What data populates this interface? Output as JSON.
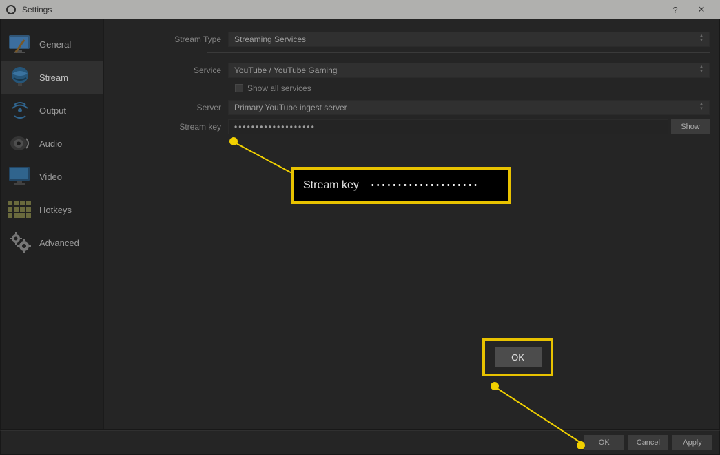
{
  "window": {
    "title": "Settings",
    "help": "?",
    "close": "✕"
  },
  "sidebar": {
    "items": [
      {
        "label": "General"
      },
      {
        "label": "Stream"
      },
      {
        "label": "Output"
      },
      {
        "label": "Audio"
      },
      {
        "label": "Video"
      },
      {
        "label": "Hotkeys"
      },
      {
        "label": "Advanced"
      }
    ]
  },
  "form": {
    "stream_type": {
      "label": "Stream Type",
      "value": "Streaming Services"
    },
    "service": {
      "label": "Service",
      "value": "YouTube / YouTube Gaming"
    },
    "show_all": {
      "label": "Show all services"
    },
    "server": {
      "label": "Server",
      "value": "Primary YouTube ingest server"
    },
    "stream_key": {
      "label": "Stream key",
      "value": "•••••••••••••••••••",
      "show_btn": "Show"
    }
  },
  "callout": {
    "stream_key_label": "Stream key",
    "stream_key_dots": "••••••••••••••••••••",
    "ok": "OK"
  },
  "footer": {
    "ok": "OK",
    "cancel": "Cancel",
    "apply": "Apply"
  }
}
